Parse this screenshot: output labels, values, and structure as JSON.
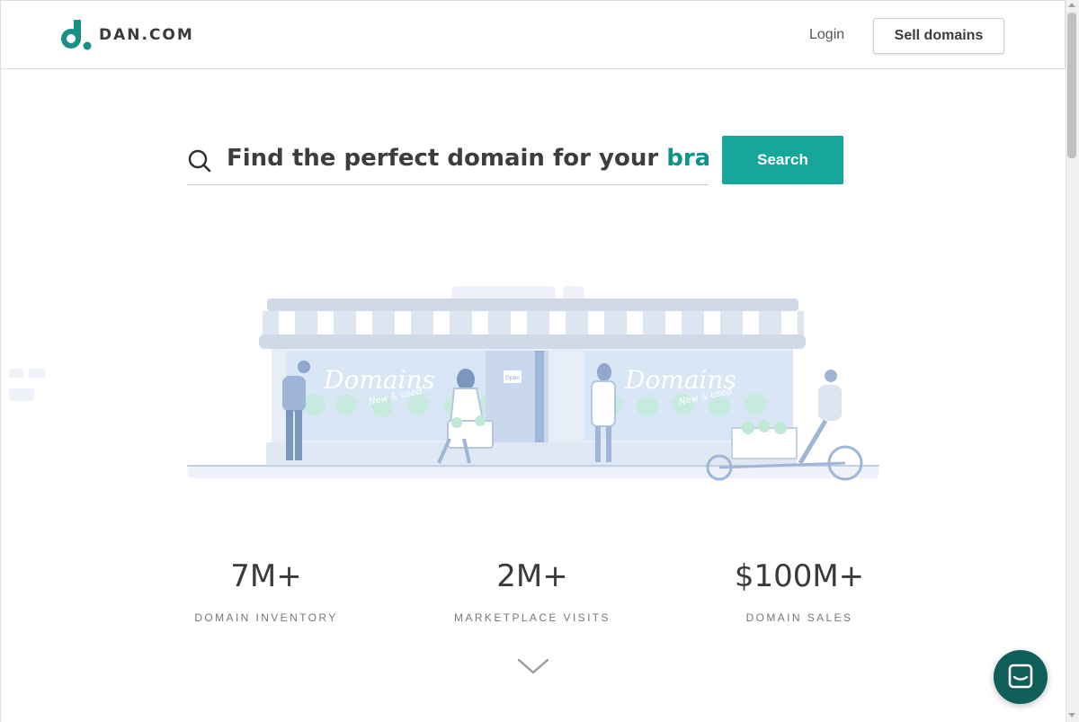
{
  "header": {
    "logo_text": "DAN.COM",
    "login_label": "Login",
    "sell_label": "Sell domains"
  },
  "search": {
    "prompt_text": "Find the perfect domain for your",
    "highlight_text": "bran",
    "button_label": "Search",
    "icon": "search-icon"
  },
  "illustration": {
    "sign_text": "Domains",
    "sign_subtext": "New & used",
    "door_sign_text": "Open"
  },
  "stats": [
    {
      "value": "7M+",
      "label": "DOMAIN INVENTORY"
    },
    {
      "value": "2M+",
      "label": "MARKETPLACE VISITS"
    },
    {
      "value": "$100M+",
      "label": "DOMAIN SALES"
    }
  ],
  "colors": {
    "brand_teal": "#16a69a",
    "brand_teal_dark": "#0d9488",
    "chat_bubble": "#0f5e5a"
  },
  "icons": {
    "scroll_hint": "chevron-down-icon",
    "chat": "chat-icon"
  }
}
